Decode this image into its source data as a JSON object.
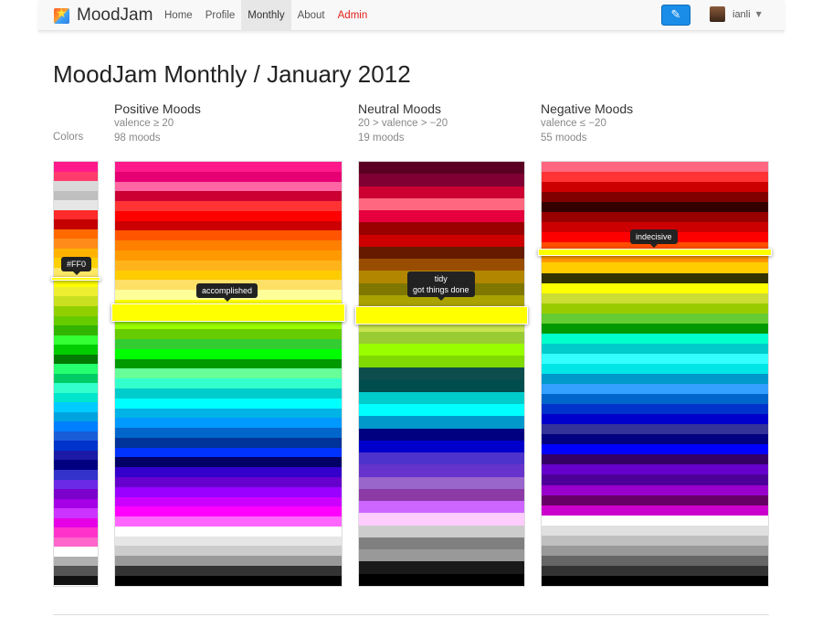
{
  "brand": {
    "name": "MoodJam"
  },
  "nav": {
    "items": [
      "Home",
      "Profile",
      "Monthly",
      "About",
      "Admin"
    ],
    "active": "Monthly"
  },
  "user": {
    "name": "ianli"
  },
  "page": {
    "title": "MoodJam Monthly / January 2012"
  },
  "colors_label": "Colors",
  "columns": {
    "positive": {
      "title": "Positive Moods",
      "rule": "valence ≥ 20",
      "count": "98 moods"
    },
    "neutral": {
      "title": "Neutral Moods",
      "rule": "20 > valence > −20",
      "count": "19 moods"
    },
    "negative": {
      "title": "Negative Moods",
      "rule": "valence ≤ −20",
      "count": "55 moods"
    }
  },
  "tooltips": {
    "colors": "#FF0",
    "positive": "accomplished",
    "neutral_line1": "tidy",
    "neutral_line2": "got things done",
    "negative": "indecisive"
  },
  "strips": {
    "colors": [
      "#ff1a8c",
      "#ff3b6b",
      "#d9d9d9",
      "#bfbfbf",
      "#e6e6e6",
      "#ff2a2a",
      "#c40000",
      "#ff6a00",
      "#ff8c1a",
      "#ffb300",
      "#ffd000",
      "#ffe866",
      "#ffff00",
      "#eeee30",
      "#c8e020",
      "#90d000",
      "#66cc00",
      "#33b400",
      "#33ff33",
      "#00cc00",
      "#007a00",
      "#26ff6e",
      "#00cc66",
      "#33ffcc",
      "#00e5cc",
      "#00ccff",
      "#00a3e0",
      "#0080ff",
      "#1a5dd9",
      "#0033cc",
      "#1a1aa6",
      "#000080",
      "#3333cc",
      "#6a2ae6",
      "#7b00cc",
      "#a500e6",
      "#cc33ff",
      "#e600e6",
      "#ff33cc",
      "#ff66cc",
      "#ffffff",
      "#b0b0b0",
      "#555555",
      "#111111"
    ],
    "positive": [
      "#ff1a8c",
      "#e60073",
      "#ff66a3",
      "#cc0033",
      "#ff3333",
      "#ff0000",
      "#cc0000",
      "#ff5500",
      "#ff7f00",
      "#ff9900",
      "#ffb31a",
      "#ffcc00",
      "#ffe066",
      "#ffff99",
      "#ffff00",
      "#ccff33",
      "#99ff00",
      "#66cc00",
      "#33cc33",
      "#00ff00",
      "#009900",
      "#66ff99",
      "#33ffcc",
      "#00cccc",
      "#00ffff",
      "#00b3e6",
      "#0099ff",
      "#0066cc",
      "#003399",
      "#0033ff",
      "#000066",
      "#3300cc",
      "#6600cc",
      "#9900ff",
      "#cc00ff",
      "#ff00ff",
      "#ff66ff",
      "#ffffff",
      "#e6e6e6",
      "#cccccc",
      "#999999",
      "#333333",
      "#000000"
    ],
    "neutral": [
      "#5a0022",
      "#800033",
      "#cc0033",
      "#ff6680",
      "#e6003d",
      "#990000",
      "#cc0000",
      "#661a00",
      "#994d00",
      "#b38600",
      "#807700",
      "#aaa200",
      "#ffff00",
      "#c8e64c",
      "#99cc33",
      "#99ff00",
      "#80d900",
      "#0d4d4d",
      "#004d4d",
      "#00cccc",
      "#00ffff",
      "#0099cc",
      "#000080",
      "#0000cc",
      "#4d33cc",
      "#6633cc",
      "#9966cc",
      "#8b3aa6",
      "#cc66ff",
      "#ffccff",
      "#cccccc",
      "#808080",
      "#999999",
      "#1a1a1a",
      "#000000"
    ],
    "negative": [
      "#ff6680",
      "#ff3333",
      "#cc0000",
      "#800000",
      "#330000",
      "#990000",
      "#cc0000",
      "#ff0000",
      "#ff4d00",
      "#ff9900",
      "#ffcc00",
      "#333300",
      "#ffff00",
      "#ccdd33",
      "#99cc00",
      "#66cc33",
      "#009900",
      "#00ffcc",
      "#00cccc",
      "#33ffff",
      "#00e6e6",
      "#0099cc",
      "#33a0ff",
      "#0066cc",
      "#0033cc",
      "#0000cc",
      "#333399",
      "#000080",
      "#0000ff",
      "#330066",
      "#6600cc",
      "#4d0099",
      "#9900cc",
      "#660066",
      "#cc00cc",
      "#ffffff",
      "#e0e0e0",
      "#bfbfbf",
      "#999999",
      "#666666",
      "#333333",
      "#000000"
    ]
  }
}
